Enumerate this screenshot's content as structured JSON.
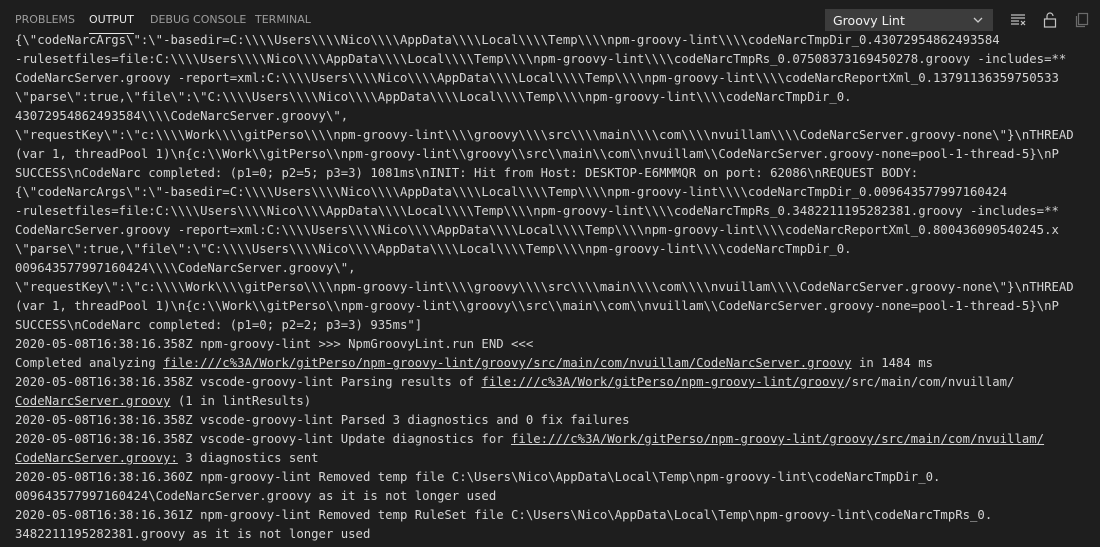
{
  "tabs": [
    {
      "label": "PROBLEMS",
      "active": false
    },
    {
      "label": "OUTPUT",
      "active": true
    },
    {
      "label": "DEBUG CONSOLE",
      "active": false
    },
    {
      "label": "TERMINAL",
      "active": false
    }
  ],
  "output_channel": {
    "selected": "Groovy Lint"
  },
  "actions": [
    {
      "name": "clear-output-icon",
      "title": "Clear Output"
    },
    {
      "name": "lock-scroll-icon",
      "title": "Turn Auto Scrolling Off"
    },
    {
      "name": "open-log-icon",
      "title": "Open Log Output File"
    }
  ],
  "output_lines": [
    [
      {
        "text": "{\\\"codeNarcArgs\\\":\\\"-basedir=C:\\\\\\\\Users\\\\\\\\Nico\\\\\\\\AppData\\\\\\\\Local\\\\\\\\Temp\\\\\\\\npm-groovy-lint\\\\\\\\codeNarcTmpDir_0.430729548624935​84"
      }
    ],
    [
      {
        "text": "-rulesetfiles=file:C:\\\\\\\\Users\\\\\\\\Nico\\\\\\\\AppData\\\\\\\\Local\\\\\\\\Temp\\\\\\\\npm-groovy-lint\\\\\\\\codeNarcTmpRs_0.0750837316​9450278.groovy -includes=**"
      }
    ],
    [
      {
        "text": "CodeNarcServer.groovy -report=xml:C:\\\\\\\\Users\\\\\\\\Nico\\\\\\\\AppData\\\\\\\\Local\\\\\\\\Temp\\\\\\\\npm-groovy-lint\\\\\\\\codeNarcReportXml_0.13791136359750533"
      }
    ],
    [
      {
        "text": "\\\"parse\\\":true,\\\"file\\\":\\\"C:\\\\\\\\Users\\\\\\\\Nico\\\\\\\\AppData\\\\\\\\Local\\\\\\\\Temp\\\\\\\\npm-groovy-lint\\\\\\\\codeNarcTmpDir_0."
      }
    ],
    [
      {
        "text": "43072954862493584\\\\\\\\CodeNarcServer.groovy\\\","
      }
    ],
    [
      {
        "text": "\\\"requestKey\\\":\\\"c:\\\\\\\\Work\\\\\\\\gitPerso\\\\\\\\npm-groovy-lint\\\\\\\\groovy\\\\\\\\src\\\\\\\\main\\\\\\\\com\\\\\\\\nvuillam\\\\\\\\CodeNarcServer.groovy-none\\\"}\\nTHREAD"
      }
    ],
    [
      {
        "text": "(var 1, threadPool 1)\\n{c:\\\\Work\\\\gitPerso\\\\npm-groovy-lint\\\\groovy\\\\src\\\\main\\\\com\\\\nvuillam\\\\CodeNarcServer.groovy-none=pool-1-thread-5}\\nP"
      }
    ],
    [
      {
        "text": "SUCCESS\\nCodeNarc completed: (p1=0; p2=5; p3=3) 1081ms\\nINIT: Hit from Host: DESKTOP-E6MMMQR on port: 62086\\nREQUEST BODY:"
      }
    ],
    [
      {
        "text": "{\\\"codeNarcArgs\\\":\\\"-basedir=C:\\\\\\\\Users\\\\\\\\Nico\\\\\\\\AppData\\\\\\\\Local\\\\\\\\Temp\\\\\\\\npm-groovy-lint\\\\\\\\codeNarcTmpDir_0.009643577997160424"
      }
    ],
    [
      {
        "text": "-rulesetfiles=file:C:\\\\\\\\Users\\\\\\\\Nico\\\\\\\\AppData\\\\\\\\Local\\\\\\\\Temp\\\\\\\\npm-groovy-lint\\\\\\\\codeNarcTmpRs_0.3482211195282381.groovy -includes=**"
      }
    ],
    [
      {
        "text": "CodeNarcServer.groovy -report=xml:C:\\\\\\\\Users\\\\\\\\Nico\\\\\\\\AppData\\\\\\\\Local\\\\\\\\Temp\\\\\\\\npm-groovy-lint\\\\\\\\codeNarcReportXml_0.800436090540245.x"
      }
    ],
    [
      {
        "text": "\\\"parse\\\":true,\\\"file\\\":\\\"C:\\\\\\\\Users\\\\\\\\Nico\\\\\\\\AppData\\\\\\\\Local\\\\\\\\Temp\\\\\\\\npm-groovy-lint\\\\\\\\codeNarcTmpDir_0."
      }
    ],
    [
      {
        "text": "009643577997160424\\\\\\\\CodeNarcServer.groovy\\\","
      }
    ],
    [
      {
        "text": "\\\"requestKey\\\":\\\"c:\\\\\\\\Work\\\\\\\\gitPerso\\\\\\\\npm-groovy-lint\\\\\\\\groovy\\\\\\\\src\\\\\\\\main\\\\\\\\com\\\\\\\\nvuillam\\\\\\\\CodeNarcServer.groovy-none\\\"}\\nTHREAD"
      }
    ],
    [
      {
        "text": "(var 1, threadPool 1)\\n{c:\\\\Work\\\\gitPerso\\\\npm-groovy-lint\\\\groovy\\\\src\\\\main\\\\com\\\\nvuillam\\\\CodeNarcServer.groovy-none=pool-1-thread-5}\\nP"
      }
    ],
    [
      {
        "text": "SUCCESS\\nCodeNarc completed: (p1=0; p2=2; p3=3) 935ms\"]"
      }
    ],
    [
      {
        "text": "2020-05-08T16:38:16.358Z npm-groovy-lint >>> NpmGroovyLint.run END <<<"
      }
    ],
    [
      {
        "text": "Completed analyzing "
      },
      {
        "text": "file:///c%3A/Work/gitPerso/npm-groovy-lint/groovy/src/main/com/nvuillam/CodeNarcServer.groovy",
        "link": true
      },
      {
        "text": " in 1484 ms"
      }
    ],
    [
      {
        "text": "2020-05-08T16:38:16.358Z vscode-groovy-lint Parsing results of "
      },
      {
        "text": "file:///c%3A/Work/gitPerso/npm-groovy-lint/groovy",
        "link": true
      },
      {
        "text": "/src/main/com/nvuillam/"
      }
    ],
    [
      {
        "text": "CodeNarcServer.groovy",
        "link": true
      },
      {
        "text": " (1 in lintResults)"
      }
    ],
    [
      {
        "text": "2020-05-08T16:38:16.358Z vscode-groovy-lint Parsed 3 diagnostics and 0 fix failures"
      }
    ],
    [
      {
        "text": "2020-05-08T16:38:16.358Z vscode-groovy-lint Update diagnostics for "
      },
      {
        "text": "file:///c%3A/Work/gitPerso/npm-groovy-lint/groovy/src/main/com/nvuillam/",
        "link": true
      }
    ],
    [
      {
        "text": "CodeNarcServer.groovy:",
        "link": true
      },
      {
        "text": " 3 diagnostics sent"
      }
    ],
    [
      {
        "text": "2020-05-08T16:38:16.360Z npm-groovy-lint Removed temp file C:\\Users\\Nico\\AppData\\Local\\Temp\\npm-groovy-lint\\codeNarcTmpDir_0."
      }
    ],
    [
      {
        "text": "009643577997160424\\CodeNarcServer.groovy as it is not longer used"
      }
    ],
    [
      {
        "text": "2020-05-08T16:38:16.361Z npm-groovy-lint Removed temp RuleSet file C:\\Users\\Nico\\AppData\\Local\\Temp\\npm-groovy-lint\\codeNarcTmpRs_0."
      }
    ],
    [
      {
        "text": "3482211195282381.groovy as it is not longer used"
      }
    ]
  ]
}
